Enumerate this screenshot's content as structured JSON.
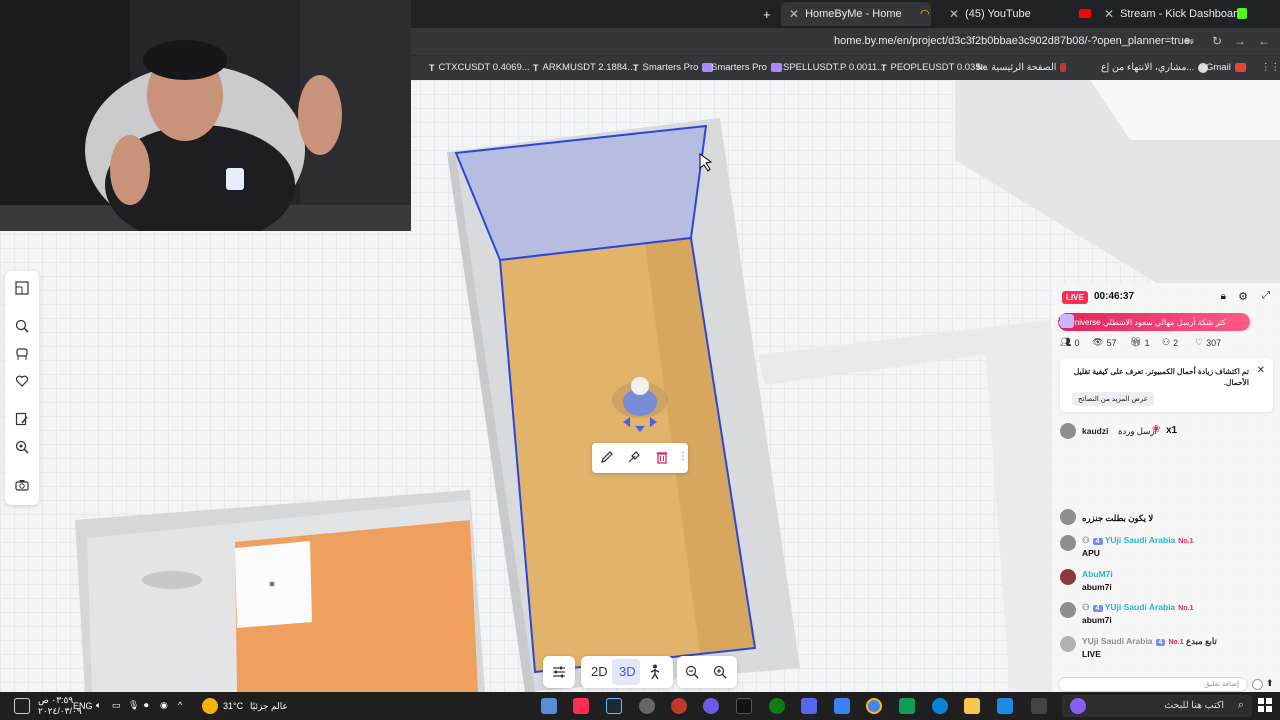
{
  "browser": {
    "tabs": [
      {
        "label": "HomeByMe - Home",
        "active": true
      },
      {
        "label": "(45) YouTube",
        "active": false
      },
      {
        "label": "Stream - Kick Dashboard",
        "active": false
      }
    ],
    "url": "home.by.me/en/project/d3c3f2b0bbae3c902d87b08/-?open_planner=true",
    "bookmarks": [
      "CTXCUSDT 0.4069...",
      "ARKMUSDT 2.1884...",
      "Smarters Pro",
      "Smarters Pro",
      "SPELLUSDT.P 0.0011...",
      "PEOPLEUSDT 0.035...",
      "الصفحة الرئيسية",
      "مشاري، الانتهاء من إع...",
      "Gmail"
    ]
  },
  "planner": {
    "left_tools": [
      "floorplan-icon",
      "search-icon",
      "furniture-icon",
      "favorite-icon",
      "edit-list-icon",
      "inspect-icon",
      "camera-icon"
    ],
    "context_tools": [
      "pencil-icon",
      "eyedropper-icon",
      "trash-icon",
      "drag-handle-icon"
    ],
    "view_2d": "2D",
    "view_3d": "3D",
    "selected_view": "3D",
    "wall_highlight_color": "#2b47d9",
    "floor_color": "#e2b36b"
  },
  "stream_overlay": {
    "live_label": "LIVE",
    "elapsed": "00:46:37",
    "banner": "TikTok Universe كثر شكة أرسل مهالي سعود الاشطلي",
    "stats": {
      "shares": "0",
      "viewers": "57",
      "gifts": "1",
      "joins": "2",
      "likes": "307"
    },
    "notice_text": "تم اكتشاف زيادة أحمال الكمبيوتر. تعرف على كيفية تقليل الأحمال.",
    "notice_link": "عرض المزيد من النصائح",
    "gift": {
      "user": "kaudzi",
      "text": "أرسل وردة",
      "count": "x1"
    },
    "chat": [
      {
        "name": "",
        "message": "لا يكون بطلت جنزره"
      },
      {
        "name": "YUji Saudi Arabia",
        "level": "4",
        "badge": "No.1",
        "message": "APU"
      },
      {
        "name": "AbuM7i",
        "level": "",
        "badge": "",
        "message": "abum7i"
      },
      {
        "name": "YUji Saudi Arabia",
        "level": "4",
        "badge": "No.1",
        "message": "abum7i"
      },
      {
        "name": "YUji Saudi Arabia",
        "level": "4",
        "badge": "No.1",
        "message": "LIVE",
        "suffix": "تابع مبدع"
      }
    ],
    "input_placeholder": "إضافة تعليق"
  },
  "taskbar": {
    "time": "٠٣:٥٩ ص",
    "date": "٢٠٢٤/٠٣/٠٩",
    "language": "ENG",
    "weather_temp": "31°C",
    "weather_text": "عالم جزئيًا",
    "search_placeholder": "اكتب هنا للبحث"
  }
}
